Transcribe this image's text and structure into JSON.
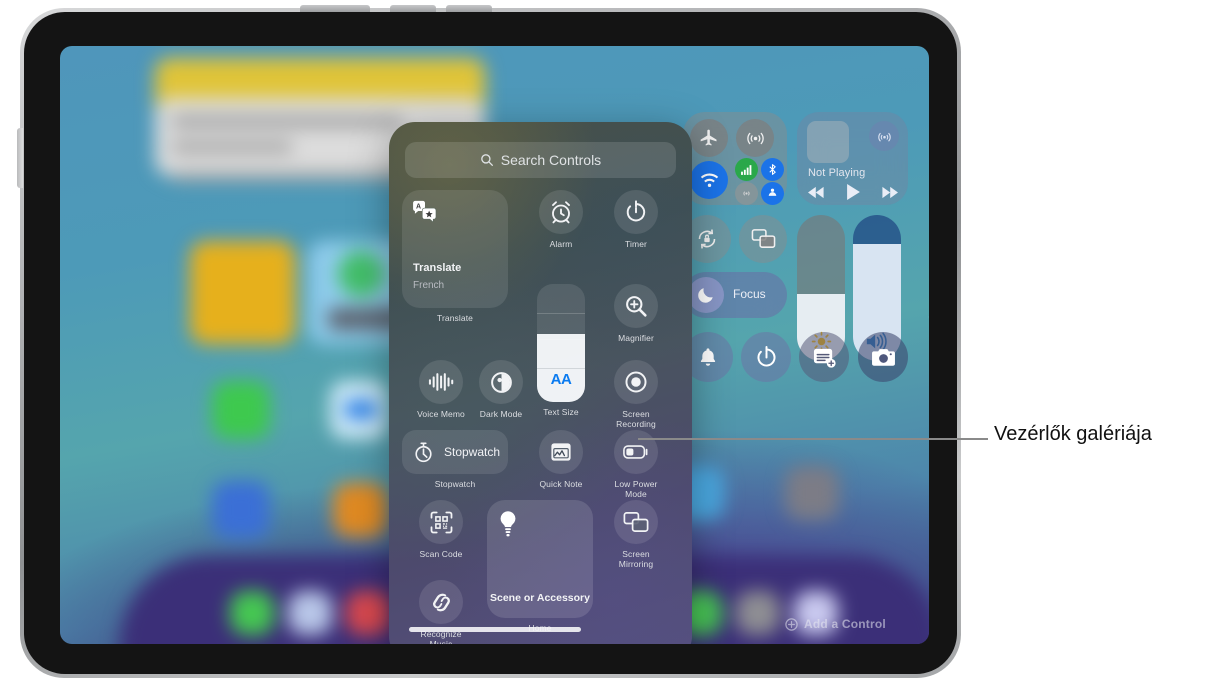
{
  "callout": {
    "label": "Vezérlők galériája"
  },
  "gallery": {
    "search": {
      "placeholder": "Search Controls",
      "icon": "search-icon"
    },
    "rows": [
      {
        "items": [
          {
            "key": "translate",
            "label": "Translate",
            "inner_title": "Translate",
            "inner_subtitle": "French",
            "icon": "translate-icon",
            "style": "wide-tall"
          },
          {
            "key": "alarm",
            "label": "Alarm",
            "icon": "alarm-clock-icon",
            "style": "circle"
          },
          {
            "key": "timer",
            "label": "Timer",
            "icon": "timer-icon",
            "style": "circle"
          }
        ]
      },
      {
        "items": [
          {
            "key": "text-size",
            "label": "Text Size",
            "icon": "text-size-icon",
            "value_label": "AA",
            "style": "slider"
          },
          {
            "key": "magnifier",
            "label": "Magnifier",
            "icon": "magnifier-icon",
            "style": "circle"
          }
        ]
      },
      {
        "items": [
          {
            "key": "voice-memo",
            "label": "Voice Memo",
            "icon": "waveform-icon",
            "style": "circle"
          },
          {
            "key": "dark-mode",
            "label": "Dark Mode",
            "icon": "dark-mode-icon",
            "style": "circle"
          },
          {
            "key": "screen-recording",
            "label": "Screen Recording",
            "icon": "record-icon",
            "style": "circle"
          }
        ]
      },
      {
        "items": [
          {
            "key": "stopwatch",
            "label": "Stopwatch",
            "inner_title": "Stopwatch",
            "icon": "stopwatch-icon",
            "style": "wide"
          },
          {
            "key": "quick-note",
            "label": "Quick Note",
            "icon": "quick-note-icon",
            "style": "circle"
          },
          {
            "key": "low-power-mode",
            "label": "Low Power Mode",
            "icon": "battery-icon",
            "style": "circle"
          }
        ]
      },
      {
        "items": [
          {
            "key": "scan-code",
            "label": "Scan Code",
            "icon": "qr-code-icon",
            "style": "circle"
          },
          {
            "key": "scene-or-accessory",
            "label": "Home",
            "inner_title": "Scene or Accessory",
            "icon": "lightbulb-icon",
            "style": "wide-tall"
          },
          {
            "key": "screen-mirroring",
            "label": "Screen Mirroring",
            "icon": "screen-mirroring-icon",
            "style": "circle"
          },
          {
            "key": "recognize-music",
            "label": "Recognize Music",
            "icon": "shazam-icon",
            "style": "circle"
          }
        ]
      }
    ]
  },
  "control_center": {
    "connectivity": {
      "airplane": {
        "name": "Airplane Mode",
        "icon": "airplane-icon",
        "active": false
      },
      "airdrop_large": {
        "name": "AirDrop",
        "icon": "airdrop-icon",
        "active": false
      },
      "wifi": {
        "name": "Wi-Fi",
        "icon": "wifi-icon",
        "active": true,
        "color": "#1b73e8"
      },
      "cellular": {
        "name": "Cellular Data",
        "icon": "cellular-bars-icon",
        "active": true,
        "color": "#2aa84a"
      },
      "bluetooth": {
        "name": "Bluetooth",
        "icon": "bluetooth-icon",
        "active": true,
        "color": "#1b73e8"
      },
      "airdrop": {
        "name": "AirDrop",
        "icon": "airdrop-icon",
        "active": false
      },
      "hotspot": {
        "name": "Personal Hotspot",
        "icon": "hotspot-icon",
        "active": true,
        "color": "#1b73e8"
      }
    },
    "media": {
      "title": "Not Playing",
      "airplay_icon": "airplay-audio-icon",
      "controls": [
        "rewind-icon",
        "play-icon",
        "fast-forward-icon"
      ]
    },
    "rotation_lock": {
      "name": "Rotation Lock",
      "icon": "rotation-lock-icon"
    },
    "screen_mirroring": {
      "name": "Screen Mirroring",
      "icon": "screen-mirroring-icon"
    },
    "focus": {
      "label": "Focus",
      "icon": "moon-icon"
    },
    "brightness": {
      "name": "Brightness",
      "icon": "brightness-icon",
      "level_percent": 46
    },
    "volume": {
      "name": "Volume",
      "icon": "volume-icon",
      "level_percent": 80
    },
    "shortcuts": [
      {
        "key": "ring-silent",
        "name": "Ring/Silent",
        "icon": "bell-icon"
      },
      {
        "key": "timer",
        "name": "Timer",
        "icon": "timer-icon"
      },
      {
        "key": "quick-note",
        "name": "Quick Note",
        "icon": "quick-note-icon"
      },
      {
        "key": "camera",
        "name": "Camera",
        "icon": "camera-icon"
      }
    ],
    "side_icons": [
      {
        "key": "health",
        "icon": "heart-icon"
      },
      {
        "key": "music",
        "icon": "music-note-icon"
      },
      {
        "key": "broadcast",
        "icon": "broadcast-icon"
      },
      {
        "key": "circle",
        "icon": "circle-icon"
      }
    ],
    "add_control": {
      "label": "Add a Control",
      "icon": "plus-circle-icon"
    }
  }
}
